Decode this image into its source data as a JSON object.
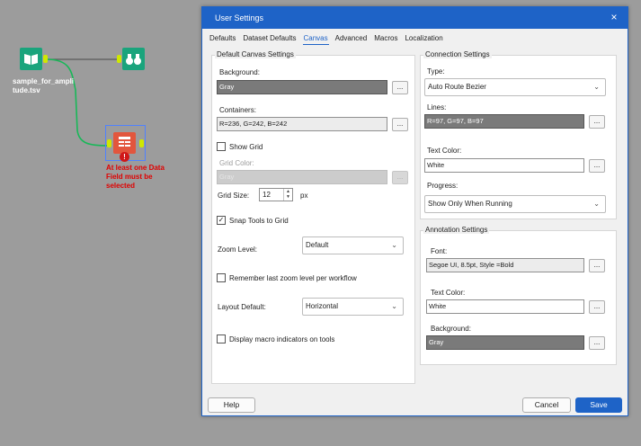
{
  "canvas": {
    "input_tool_label": "sample_for_ampli\ntude.tsv",
    "error_text": "At least one Data Field must be selected"
  },
  "dialog": {
    "title": "User Settings",
    "close_glyph": "×",
    "tabs": [
      "Defaults",
      "Dataset Defaults",
      "Canvas",
      "Advanced",
      "Macros",
      "Localization"
    ],
    "active_tab": "Canvas",
    "default_canvas": {
      "title": "Default Canvas Settings",
      "background_label": "Background:",
      "background_value": "Gray",
      "containers_label": "Containers:",
      "containers_value": "R=236, G=242, B=242",
      "show_grid_label": "Show Grid",
      "show_grid_checked": false,
      "grid_color_label": "Grid Color:",
      "grid_color_value": "Gray",
      "grid_size_label": "Grid Size:",
      "grid_size_value": "12",
      "grid_size_unit": "px",
      "snap_label": "Snap Tools to Grid",
      "snap_checked": true,
      "zoom_label": "Zoom Level:",
      "zoom_value": "Default",
      "remember_zoom_label": "Remember last zoom level per workflow",
      "remember_zoom_checked": false,
      "layout_label": "Layout Default:",
      "layout_value": "Horizontal",
      "macro_ind_label": "Display macro indicators on tools",
      "macro_ind_checked": false
    },
    "connection": {
      "title": "Connection Settings",
      "type_label": "Type:",
      "type_value": "Auto Route Bezier",
      "lines_label": "Lines:",
      "lines_value": "R=97, G=97, B=97",
      "text_color_label": "Text Color:",
      "text_color_value": "White",
      "progress_label": "Progress:",
      "progress_value": "Show Only When Running"
    },
    "annotation": {
      "title": "Annotation Settings",
      "font_label": "Font:",
      "font_value": "Segoe UI, 8.5pt, Style =Bold",
      "text_color_label": "Text Color:",
      "text_color_value": "White",
      "background_label": "Background:",
      "background_value": "Gray"
    },
    "browse_label": "...",
    "chevron": "⌄",
    "check_glyph": "✓",
    "buttons": {
      "help": "Help",
      "cancel": "Cancel",
      "save": "Save"
    }
  },
  "colors": {
    "accent": "#1e63c7",
    "canvas_bg": "#9c9c9c",
    "error": "#e00000",
    "connector": "#cfe800"
  }
}
